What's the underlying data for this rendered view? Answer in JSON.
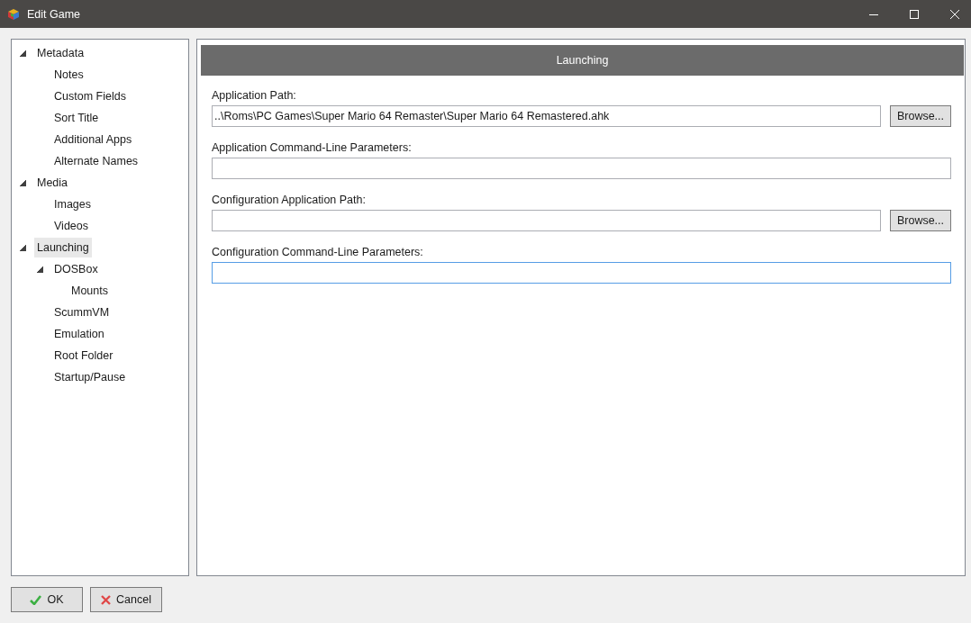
{
  "window": {
    "title": "Edit Game"
  },
  "tree": [
    {
      "label": "Metadata",
      "expanded": true,
      "selected": false,
      "children": [
        {
          "label": "Notes",
          "selected": false
        },
        {
          "label": "Custom Fields",
          "selected": false
        },
        {
          "label": "Sort Title",
          "selected": false
        },
        {
          "label": "Additional Apps",
          "selected": false
        },
        {
          "label": "Alternate Names",
          "selected": false
        }
      ]
    },
    {
      "label": "Media",
      "expanded": true,
      "selected": false,
      "children": [
        {
          "label": "Images",
          "selected": false
        },
        {
          "label": "Videos",
          "selected": false
        }
      ]
    },
    {
      "label": "Launching",
      "expanded": true,
      "selected": true,
      "children": [
        {
          "label": "DOSBox",
          "expanded": true,
          "selected": false,
          "children": [
            {
              "label": "Mounts",
              "selected": false
            }
          ]
        },
        {
          "label": "ScummVM",
          "selected": false
        },
        {
          "label": "Emulation",
          "selected": false
        },
        {
          "label": "Root Folder",
          "selected": false
        },
        {
          "label": "Startup/Pause",
          "selected": false
        }
      ]
    }
  ],
  "panel": {
    "title": "Launching",
    "fields": [
      {
        "label": "Application Path:",
        "value": "..\\Roms\\PC Games\\Super Mario 64 Remaster\\Super Mario 64 Remastered.ahk",
        "focused": false,
        "button": "Browse..."
      },
      {
        "label": "Application Command-Line Parameters:",
        "focused": false
      },
      {
        "label": "Configuration Application Path:",
        "focused": false,
        "button": "Browse..."
      },
      {
        "label": "Configuration Command-Line Parameters:",
        "focused": true
      }
    ]
  },
  "buttons": [
    {
      "kind": "ok",
      "label": "OK"
    },
    {
      "kind": "cancel",
      "label": "Cancel"
    }
  ]
}
